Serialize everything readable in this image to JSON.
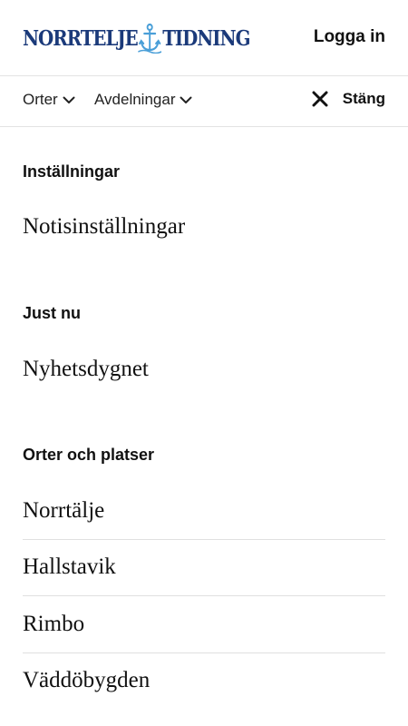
{
  "header": {
    "logo_left": "NORRTELJE",
    "logo_right": "TIDNING",
    "login_label": "Logga in"
  },
  "subnav": {
    "orter_label": "Orter",
    "avdelningar_label": "Avdelningar",
    "close_label": "Stäng"
  },
  "menu": {
    "settings": {
      "title": "Inställningar",
      "items": [
        "Notisinställningar"
      ]
    },
    "just_now": {
      "title": "Just nu",
      "items": [
        "Nyhetsdygnet"
      ]
    },
    "places": {
      "title": "Orter och platser",
      "items": [
        "Norrtälje",
        "Hallstavik",
        "Rimbo",
        "Väddöbygden"
      ]
    }
  },
  "colors": {
    "brand_blue": "#1b3a7a",
    "anchor_blue": "#4a9fd8",
    "divider": "#e0e0e0"
  },
  "icons": [
    "anchor-icon",
    "chevron-down-icon",
    "close-icon"
  ]
}
